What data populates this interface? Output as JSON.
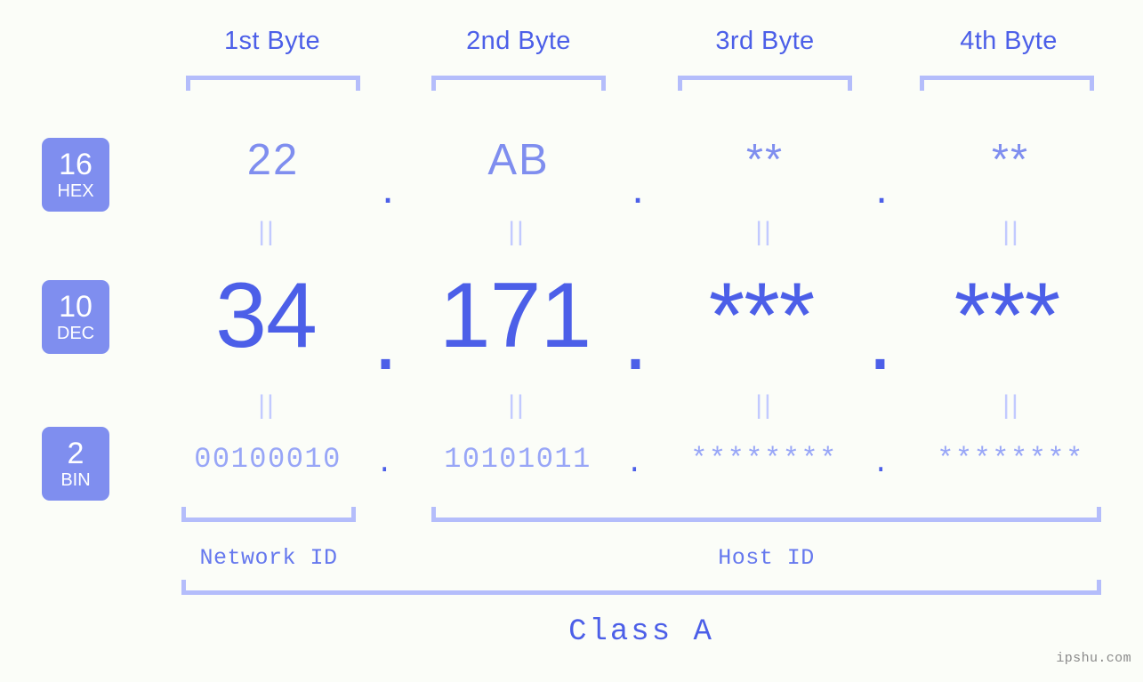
{
  "background_color": "#fbfdf8",
  "accent_color": "#4c5fe8",
  "accent_light_color": "#7f8eef",
  "bracket_color": "#b4bdfb",
  "muted_color": "#98a6f7",
  "byte_headers": [
    {
      "label": "1st Byte"
    },
    {
      "label": "2nd Byte"
    },
    {
      "label": "3rd Byte"
    },
    {
      "label": "4th Byte"
    }
  ],
  "bases": [
    {
      "number": "16",
      "name": "HEX"
    },
    {
      "number": "10",
      "name": "DEC"
    },
    {
      "number": "2",
      "name": "BIN"
    }
  ],
  "rows": {
    "hex": {
      "base_number": "16",
      "base_name": "HEX",
      "values": [
        "22",
        "AB",
        "**",
        "**"
      ],
      "separator": "."
    },
    "dec": {
      "base_number": "10",
      "base_name": "DEC",
      "values": [
        "34",
        "171",
        "***",
        "***"
      ],
      "separator": "."
    },
    "bin": {
      "base_number": "2",
      "base_name": "BIN",
      "values": [
        "00100010",
        "10101011",
        "********",
        "********"
      ],
      "separator": "."
    }
  },
  "equality_marks": {
    "hex_to_dec": [
      "||",
      "||",
      "||",
      "||"
    ],
    "dec_to_bin": [
      "||",
      "||",
      "||",
      "||"
    ]
  },
  "regions": [
    {
      "label": "Network ID"
    },
    {
      "label": "Host ID"
    }
  ],
  "class_label": "Class A",
  "watermark": "ipshu.com"
}
